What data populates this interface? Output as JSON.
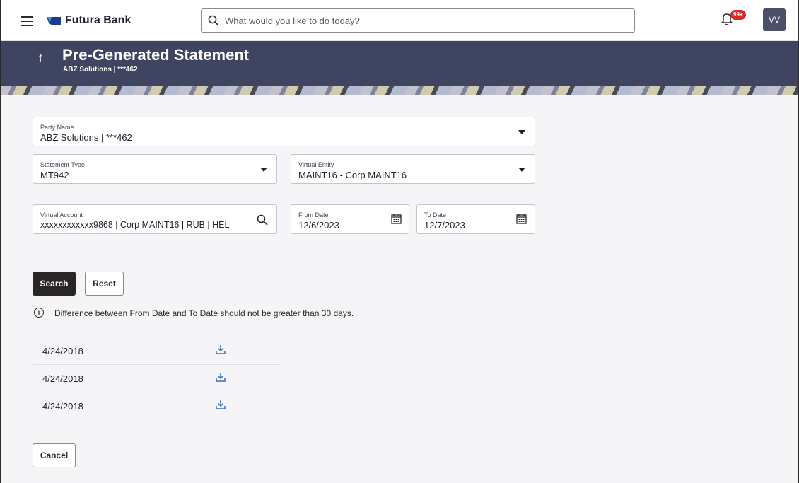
{
  "topbar": {
    "brand_name": "Futura Bank",
    "search_placeholder": "What would you like to do today?",
    "notification_badge": "99+",
    "avatar_initials": "VV"
  },
  "header": {
    "title": "Pre-Generated Statement",
    "subtitle": "ABZ Solutions | ***462"
  },
  "form": {
    "party_name": {
      "label": "Party Name",
      "value": "ABZ Solutions | ***462"
    },
    "statement_type": {
      "label": "Statement Type",
      "value": "MT942"
    },
    "virtual_entity": {
      "label": "Virtual Entity",
      "value": "MAINT16 - Corp MAINT16"
    },
    "virtual_account": {
      "label": "Virtual Account",
      "value": "xxxxxxxxxxxx9868 | Corp MAINT16 | RUB | HEL"
    },
    "from_date": {
      "label": "From Date",
      "value": "12/6/2023"
    },
    "to_date": {
      "label": "To Date",
      "value": "12/7/2023"
    }
  },
  "actions": {
    "search_label": "Search",
    "reset_label": "Reset",
    "cancel_label": "Cancel"
  },
  "info_message": "Difference between From Date and To Date should not be greater than 30 days.",
  "statements": [
    {
      "date": "4/24/2018",
      "icon": "download-icon"
    },
    {
      "date": "4/24/2018",
      "icon": "download-icon"
    },
    {
      "date": "4/24/2018",
      "icon": "download-icon"
    }
  ],
  "colors": {
    "banner": "#3f4561",
    "primary_button": "#2b2626",
    "badge": "#d62b2b",
    "download_icon": "#3a6fb0"
  }
}
